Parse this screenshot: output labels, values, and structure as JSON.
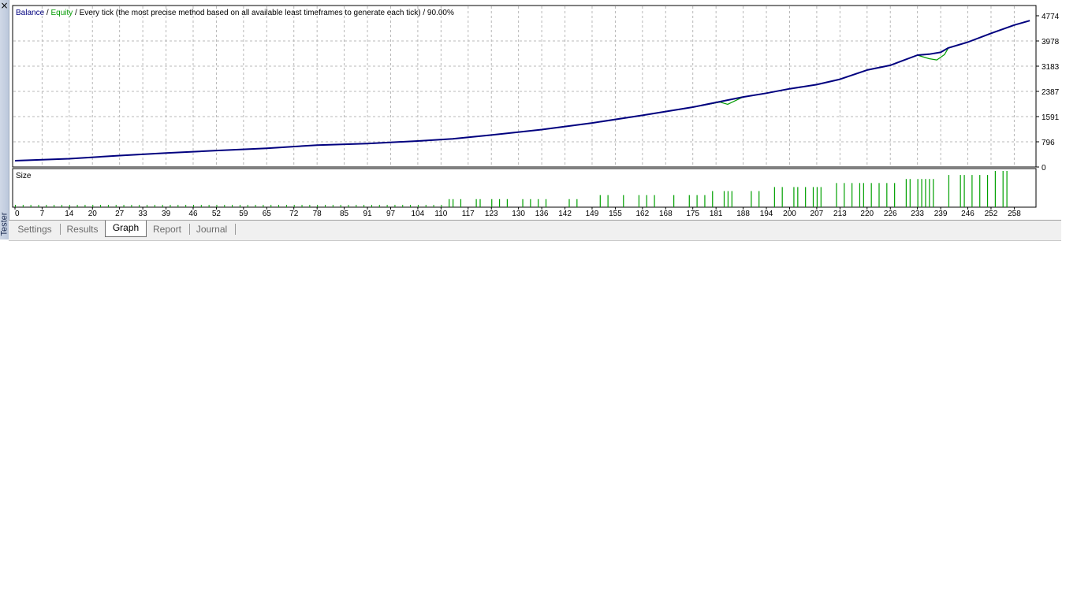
{
  "panel": {
    "title": "Tester",
    "close": "×"
  },
  "tabs": [
    {
      "label": "Settings",
      "active": false
    },
    {
      "label": "Results",
      "active": false
    },
    {
      "label": "Graph",
      "active": true
    },
    {
      "label": "Report",
      "active": false
    },
    {
      "label": "Journal",
      "active": false
    }
  ],
  "header": {
    "balance": "Balance",
    "sep1": " / ",
    "equity": "Equity",
    "rest": " / Every tick (the most precise method based on all available least timeframes to generate each tick) / 90.00%"
  },
  "size_panel": {
    "label": "Size"
  },
  "colors": {
    "balance": "#00007f",
    "equity": "#009a00",
    "volume": "#00a000",
    "grid": "#b8b8b8"
  },
  "chart_data": {
    "type": "line",
    "series": [
      {
        "name": "Balance",
        "x": [
          0,
          14,
          27,
          39,
          52,
          65,
          78,
          91,
          104,
          113,
          123,
          136,
          149,
          162,
          175,
          188,
          194,
          200,
          207,
          213,
          220,
          226,
          233,
          236,
          239,
          241,
          246,
          252,
          258,
          262
        ],
        "y": [
          200,
          260,
          360,
          440,
          520,
          590,
          690,
          740,
          820,
          890,
          1010,
          1180,
          1390,
          1630,
          1890,
          2210,
          2330,
          2470,
          2600,
          2770,
          3060,
          3210,
          3530,
          3560,
          3620,
          3760,
          3940,
          4220,
          4480,
          4620
        ]
      },
      {
        "name": "Equity",
        "x": [
          0,
          14,
          27,
          39,
          52,
          65,
          78,
          91,
          104,
          113,
          123,
          136,
          149,
          162,
          175,
          182,
          184,
          188,
          194,
          200,
          207,
          213,
          220,
          226,
          233,
          236,
          238,
          240,
          241,
          246,
          252,
          258,
          262
        ],
        "y": [
          200,
          260,
          360,
          440,
          520,
          590,
          690,
          740,
          820,
          890,
          1010,
          1180,
          1390,
          1630,
          1890,
          2050,
          1980,
          2210,
          2330,
          2470,
          2600,
          2770,
          3060,
          3210,
          3530,
          3420,
          3380,
          3550,
          3760,
          3940,
          4220,
          4480,
          4620
        ]
      }
    ],
    "volume": {
      "x": [
        112,
        113,
        115,
        119,
        120,
        123,
        125,
        127,
        131,
        133,
        135,
        137,
        143,
        145,
        151,
        153,
        157,
        161,
        163,
        165,
        170,
        174,
        176,
        178,
        180,
        183,
        184,
        185,
        190,
        192,
        196,
        198,
        201,
        202,
        204,
        206,
        207,
        208,
        212,
        214,
        216,
        218,
        219,
        221,
        223,
        225,
        227,
        230,
        231,
        233,
        234,
        235,
        236,
        237,
        241,
        244,
        245,
        247,
        249,
        251,
        253,
        255,
        256
      ],
      "v": [
        2,
        2,
        2,
        2,
        2,
        2,
        2,
        2,
        2,
        2,
        2,
        2,
        2,
        2,
        3,
        3,
        3,
        3,
        3,
        3,
        3,
        3,
        3,
        3,
        4,
        4,
        4,
        4,
        4,
        4,
        5,
        5,
        5,
        5,
        5,
        5,
        5,
        5,
        6,
        6,
        6,
        6,
        6,
        6,
        6,
        6,
        6,
        7,
        7,
        7,
        7,
        7,
        7,
        7,
        8,
        8,
        8,
        8,
        8,
        8,
        9,
        9,
        9
      ]
    },
    "y_ticks": [
      0,
      796,
      1591,
      2387,
      3183,
      3978,
      4774
    ],
    "ylim": [
      0,
      4774
    ],
    "x_ticks": [
      0,
      7,
      14,
      20,
      27,
      33,
      39,
      46,
      52,
      59,
      65,
      72,
      78,
      85,
      91,
      97,
      104,
      110,
      117,
      123,
      130,
      136,
      142,
      149,
      155,
      162,
      168,
      175,
      181,
      188,
      194,
      200,
      207,
      213,
      220,
      226,
      233,
      239,
      246,
      252,
      258
    ],
    "xlim": [
      0,
      263
    ],
    "grid": true
  }
}
